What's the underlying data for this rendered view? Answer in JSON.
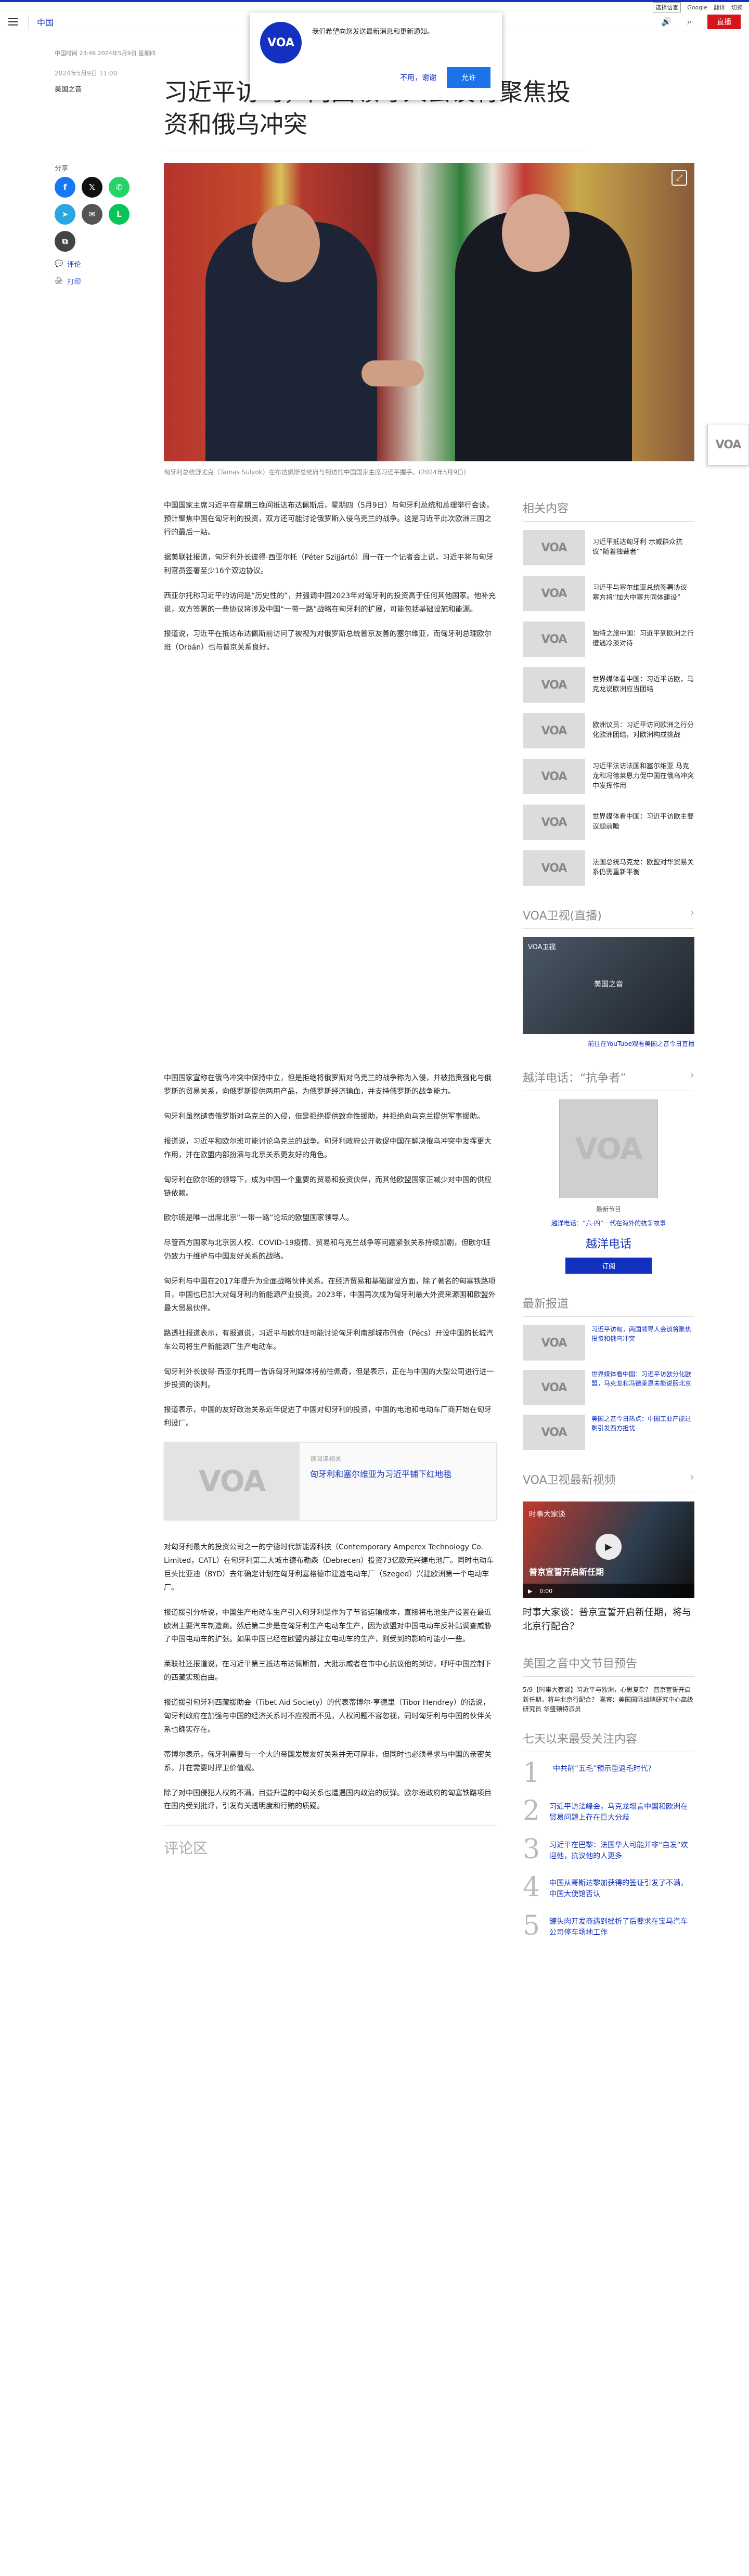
{
  "top_strip": {
    "lang_select": "选择语言",
    "links": [
      "Google",
      "翻译",
      "切换"
    ]
  },
  "header": {
    "section": "中国",
    "live_label": "直播"
  },
  "notification": {
    "logo": "VOA",
    "message": "我们希望向您发送最新消息和更新通知。",
    "no_label": "不用，谢谢",
    "yes_label": "允许"
  },
  "article": {
    "meta": "中国时间 23:46 2024年5月9日 星期四",
    "title": "习近平访匈，两国领导人会谈将聚焦投资和俄乌冲突",
    "pubdate": "2024年5月9日 11:00",
    "byline": "美国之音",
    "image_caption": "匈牙利总统舒尤克（Tamas Sulyok）在布达佩斯总统府与到访的中国国家主席习近平握手。(2024年5月9日)",
    "paragraphs_top": [
      "中国国家主席习近平在星期三晚间抵达布达佩斯后，星期四（5月9日）与匈牙利总统和总理举行会谈，预计聚焦中国在匈牙利的投资，双方还可能讨论俄罗斯入侵乌克兰的战争。这是习近平此次欧洲三国之行的最后一站。",
      "据美联社报道，匈牙利外长彼得·西亚尔托（Péter Szijjártó）周一在一个记者会上说，习近平将与匈牙利官员签署至少16个双边协议。",
      "西亚尔托称习近平的访问是“历史性的”，并强调中国2023年对匈牙利的投资高于任何其他国家。他补充说，双方签署的一些协议将涉及中国“一带一路”战略在匈牙利的扩展，可能包括基础设施和能源。",
      "报道说，习近平在抵达布达佩斯前访问了被视为对俄罗斯总统普京友善的塞尔维亚，而匈牙利总理欧尔班（Orbán）也与普京关系良好。"
    ],
    "paragraphs_bottom": [
      "中国国家宣称在俄乌冲突中保持中立，但是拒绝将俄罗斯对乌克兰的战争称为入侵，并被指责强化与俄罗斯的贸易关系，向俄罗斯提供两用产品，为俄罗斯经济输血，并支持俄罗斯的战争能力。",
      "匈牙利虽然谴责俄罗斯对乌克兰的入侵，但是拒绝提供致命性援助，并拒绝向乌克兰提供军事援助。",
      "报道说，习近平和欧尔班可能讨论乌克兰的战争。匈牙利政府公开敦促中国在解决俄乌冲突中发挥更大作用，并在欧盟内部扮演与北京关系更友好的角色。",
      "匈牙利在欧尔班的领导下，成为中国一个重要的贸易和投资伙伴，而其他欧盟国家正减少对中国的供应链依赖。",
      "欧尔班是唯一出席北京“一带一路”论坛的欧盟国家领导人。",
      "尽管西方国家与北京因人权、COVID-19疫情、贸易和乌克兰战争等问题紧张关系持续加剧，但欧尔班仍致力于维护与中国友好关系的战略。",
      "匈牙利与中国在2017年提升为全面战略伙伴关系。在经济贸易和基础建设方面，除了著名的匈塞铁路项目，中国也已加大对匈牙利的新能源产业投资。2023年，中国再次成为匈牙利最大外资来源国和欧盟外最大贸易伙伴。",
      "路透社报道表示，有报道说，习近平与欧尔班可能讨论匈牙利南部城市佩奇（Pécs）开设中国的长城汽车公司将生产新能源厂生产电动车。",
      "匈牙利外长彼得·西亚尔托周一告诉匈牙利媒体将前往佩奇，但是表示，正在与中国的大型公司进行进一步投资的谈判。",
      "报道表示，中国的友好政治关系近年促进了中国对匈牙利的投资，中国的电池和电动车厂商开始在匈牙利设厂。"
    ],
    "related": {
      "kicker": "请阅读相关",
      "title": "匈牙利和塞尔维亚为习近平铺下红地毯"
    },
    "paragraphs_after": [
      "对匈牙利最大的投资公司之一的宁德时代新能源科技（Contemporary Amperex Technology Co. Limited，CATL）在匈牙利第二大城市德布勒森（Debrecen）投资73亿欧元兴建电池厂。同时电动车巨头比亚迪（BYD）去年确定计划在匈牙利塞格德市建造电动车厂（Szeged）兴建欧洲第一个电动车厂。",
      "报道援引分析说，中国生产电动车生产引入匈牙利是作为了节省运输成本，直接将电池生产设置在最近欧洲主要汽车制造商。然后第二步是在匈牙利生产电动车生产，因为欧盟对中国电动车反补贴调查威胁了中国电动车的扩张。如果中国已经在欧盟内部建立电动车的生产，则受到的影响可能小一些。",
      "莱联社还报道说，在习近平第三抵达布达佩斯前，大批示威者在市中心抗议他的到访，呼吁中国控制下的西藏实现自由。",
      "报道援引匈牙利西藏援助会（Tibet Aid Society）的代表蒂博尔·亨德里（Tibor Hendrey）的话说，匈牙利政府在加强与中国的经济关系时不应视而不见，人权问题不容忽视，同时匈牙利与中国的伙伴关系也确实存在。",
      "蒂博尔表示，匈牙利需要与一个大的帝国发展友好关系并无可厚非，但同时也必须寻求与中国的亲密关系，并在需要时捍卫价值观。",
      "除了对中国侵犯人权的不满，目益升温的中匈关系也遭遇国内政治的反弹。欧尔班政府的匈塞铁路项目在国内受到批评，引发有关透明度和行贿的质疑。"
    ],
    "comments_heading": "评论区"
  },
  "share": {
    "label": "分享",
    "buttons": [
      "f",
      "𝕏",
      "✆",
      "➤",
      "✉",
      "L",
      "⧉"
    ],
    "comment_link": "评论",
    "print_link": "打印"
  },
  "rail": {
    "related_heading": "相关内容",
    "related_items": [
      "习近平抵达匈牙利 示威群众抗议“随着独裁者”",
      "习近平与塞尔维亚总统签署协议 塞方将“加大中塞共同体建设”",
      "独特之旅中国：习近平到欧洲之行遭遇冷淡对待",
      "世界媒体看中国：习近平访欧，马克龙说欧洲应当团结",
      "欧洲议员：习近平访问欧洲之行分化欧洲团结，对欧洲构成挑战",
      "习近平法访法国和塞尔维亚 马克龙和冯德莱恩力促中国在俄乌冲突中发挥作用",
      "世界媒体看中国：习近平访欧主要议题前瞻",
      "法国总统马克龙：欧盟对华贸易关系仍需重新平衡"
    ],
    "live_heading": "VOA卫视(直播)",
    "live_video_label": "VOA卫视",
    "live_video_brand": "美国之音",
    "live_note": "前往在YouTube观看美国之音今日直播",
    "podcast_heading": "越洋电话：“抗争者”",
    "podcast_caption": "最新节目",
    "podcast_sub": "越洋电话：“六·四”一代在海外的抗争故事",
    "podcast_name": "越洋电话",
    "subscribe_label": "订阅",
    "latest_heading": "最新报道",
    "latest_items": [
      "习近平访匈，两国领导人会谈将聚焦投资和俄乌冲突",
      "世界媒体看中国：习近平访欧分化欧盟，马克龙和冯德莱恩未能说服北京",
      "美国之音今日热点：中国工业产能过剩引发西方担忧"
    ],
    "video_heading": "VOA卫视最新视频",
    "video_title": "时事大家谈",
    "video_headline": "普京宣誓开启新任期",
    "video_time": "0:00",
    "video_after": "时事大家谈：普京宣誓开启新任期，将与北京行配合？",
    "program_heading": "美国之音中文节目预告",
    "program_text": "5/9【时事大家谈】习近平与欧洲，心思复杂？ 普京宣誓开启新任期，将与北京行配合？ 嘉宾：美国国际战略研究中心高级研究员 华盛顿特派员",
    "ranked_heading": "七天以来最受关注内容",
    "ranked_items": [
      "中共削“五毛”预示重返毛时代?",
      "习近平访法峰会，马克龙坦言中国和欧洲在贸易问题上存在巨大分歧",
      "习近平在巴黎：法国华人可能并非“自发”欢迎他，抗议他的人更多",
      "中国从哥斯达黎加获得的签证引发了不满，中国大使馆否认",
      "罐头肉开发商遇到挫折了后要求在宝马汽车公司停车场地工作"
    ],
    "floating_logo": "VOA"
  }
}
